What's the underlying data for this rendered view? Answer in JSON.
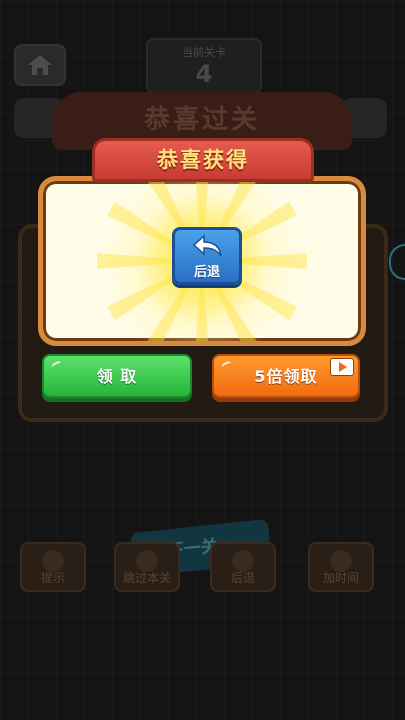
{
  "background": {
    "home_icon": "home-icon",
    "level": {
      "title": "当前关卡",
      "number": "4"
    },
    "victory_banner": "恭喜过关",
    "next_button": "下一关 »",
    "bottom_buttons": [
      {
        "label": "提示",
        "icon": "hint-icon"
      },
      {
        "label": "跳过本关",
        "icon": "skip-icon"
      },
      {
        "label": "后退",
        "icon": "undo-icon"
      },
      {
        "label": "加时间",
        "icon": "add-time-icon"
      }
    ]
  },
  "modal": {
    "title": "恭喜获得",
    "reward": {
      "label": "后退",
      "icon": "undo-arrow-icon"
    },
    "claim_button": "领 取",
    "claim5_button": "5倍领取",
    "video_icon": "video-play-icon"
  },
  "colors": {
    "green": "#26b53a",
    "orange": "#f06b10",
    "ribbon_red": "#c63c32",
    "title_yellow": "#ffe27a",
    "card_bg": "#fffce8",
    "reward_blue": "#2b6fc5"
  }
}
